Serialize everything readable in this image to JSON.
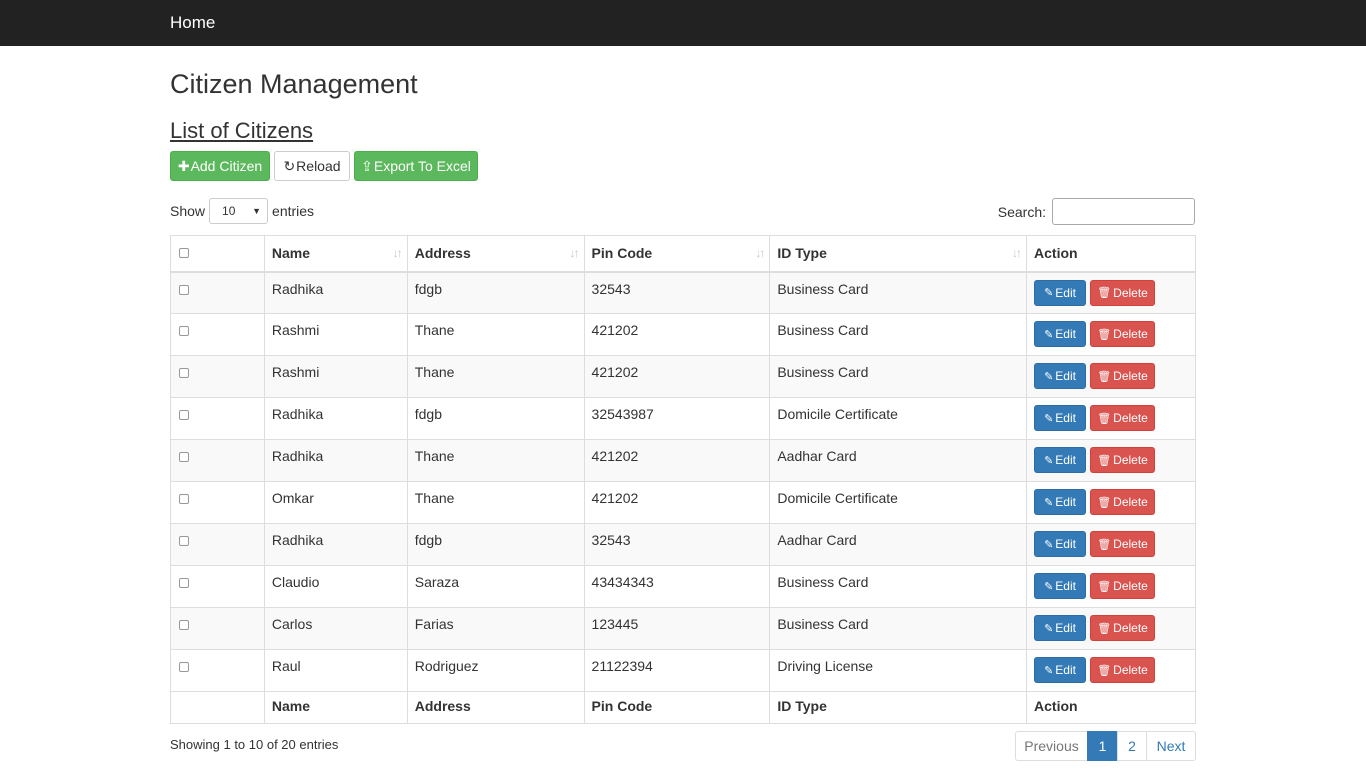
{
  "navbar": {
    "brand": "Home"
  },
  "page": {
    "title": "Citizen Management",
    "subtitle": "List of Citizens"
  },
  "toolbar": {
    "add_label": "Add Citizen",
    "reload_label": "Reload",
    "export_label": "Export To Excel",
    "add_icon": "plus-icon",
    "reload_icon": "refresh-icon",
    "export_icon": "export-icon"
  },
  "length_control": {
    "prefix": "Show",
    "value": "10",
    "suffix": "entries"
  },
  "search": {
    "label": "Search:",
    "value": ""
  },
  "table": {
    "columns": [
      "Name",
      "Address",
      "Pin Code",
      "ID Type",
      "Action"
    ],
    "rows": [
      {
        "name": "Radhika",
        "address": "fdgb",
        "pin": "32543",
        "id_type": "Business Card"
      },
      {
        "name": "Rashmi",
        "address": "Thane",
        "pin": "421202",
        "id_type": "Business Card"
      },
      {
        "name": "Rashmi",
        "address": "Thane",
        "pin": "421202",
        "id_type": "Business Card"
      },
      {
        "name": "Radhika",
        "address": "fdgb",
        "pin": "32543987",
        "id_type": "Domicile Certificate"
      },
      {
        "name": "Radhika",
        "address": "Thane",
        "pin": "421202",
        "id_type": "Aadhar Card"
      },
      {
        "name": "Omkar",
        "address": "Thane",
        "pin": "421202",
        "id_type": "Domicile Certificate"
      },
      {
        "name": "Radhika",
        "address": "fdgb",
        "pin": "32543",
        "id_type": "Aadhar Card"
      },
      {
        "name": "Claudio",
        "address": "Saraza",
        "pin": "43434343",
        "id_type": "Business Card"
      },
      {
        "name": "Carlos",
        "address": "Farias",
        "pin": "123445",
        "id_type": "Business Card"
      },
      {
        "name": "Raul",
        "address": "Rodriguez",
        "pin": "21122394",
        "id_type": "Driving License"
      }
    ],
    "edit_label": "Edit",
    "delete_label": "Delete"
  },
  "info": "Showing 1 to 10 of 20 entries",
  "pagination": {
    "previous": "Previous",
    "pages": [
      "1",
      "2"
    ],
    "next": "Next"
  },
  "colors": {
    "navbar": "#222222",
    "success": "#5cb85c",
    "primary": "#337ab7",
    "danger": "#d9534f"
  }
}
